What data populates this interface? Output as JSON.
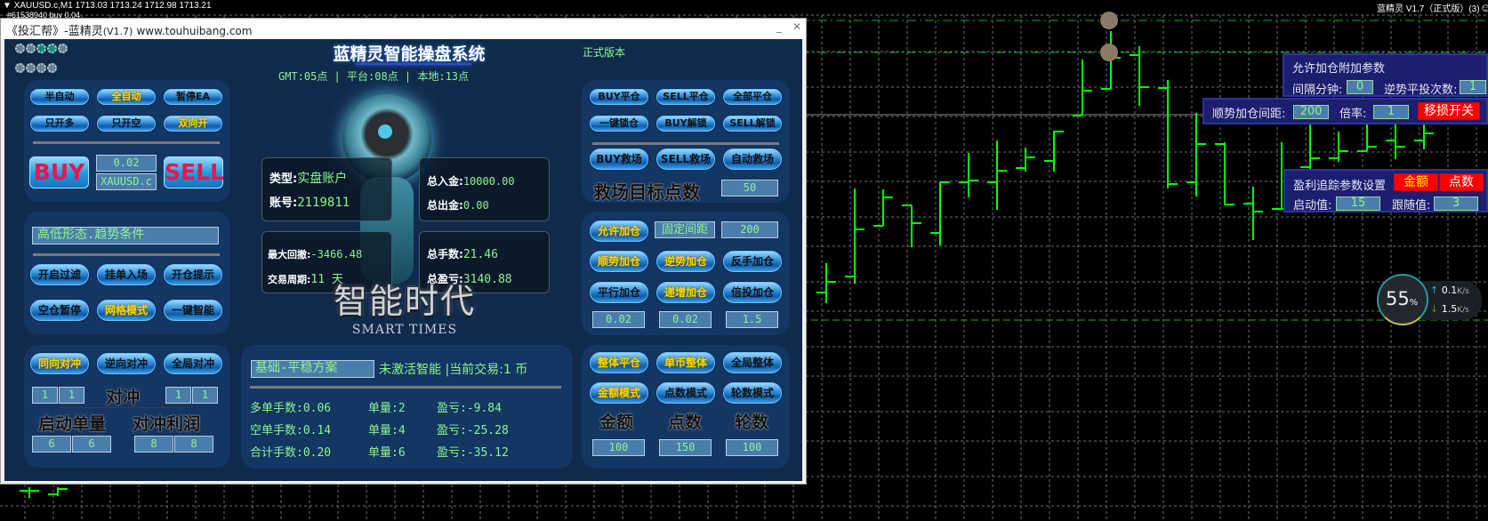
{
  "chart_header": {
    "symbol_line": "XAUUSD.c,M1  1713.03 1713.24 1712.98 1713.21",
    "position_line": "#61538940 buy 0.04",
    "ea_label": "蓝精灵 V1.7（正式版）(3)",
    "smiley": "☺"
  },
  "window": {
    "title_prefix": "《投汇帮》-蓝精灵",
    "version": "(V1.7)",
    "url": "www.touhuibang.com",
    "minimize": "_",
    "close": "✕"
  },
  "header": {
    "title": "蓝精灵智能操盘系统",
    "edition": "正式版本",
    "time_line": "GMT:05点 | 平台:08点 | 本地:13点"
  },
  "left": {
    "p1": {
      "buttons": [
        "半自动",
        "全自动",
        "暂停EA",
        "只开多",
        "只开空",
        "双向开"
      ],
      "buy": "BUY",
      "sell": "SELL",
      "lot": "0.02",
      "symbol": "XAUUSD.c"
    },
    "p2": {
      "condition": "高低形态.趋势条件",
      "buttons": [
        "开启过滤",
        "挂单入场",
        "开仓提示",
        "空仓暂停",
        "网格模式",
        "一键智能"
      ]
    },
    "p3": {
      "buttons": [
        "同向对冲",
        "逆向对冲",
        "全局对冲"
      ],
      "hedge_label": "对冲",
      "hedge_a": [
        "1",
        "1"
      ],
      "hedge_b": [
        "1",
        "1"
      ],
      "start_lot_label": "启动单量",
      "hedge_profit_label": "对冲利润",
      "start_lot": [
        "6",
        "6"
      ],
      "hedge_profit": [
        "8",
        "8"
      ]
    }
  },
  "center": {
    "account": {
      "type_k": "类型:",
      "type_v": "实盘账户",
      "acct_k": "账号:",
      "acct_v": "2119811",
      "dep_k": "总入金:",
      "dep_v": "10000.00",
      "wd_k": "总出金:",
      "wd_v": "0.00",
      "dd_k": "最大回撤:",
      "dd_v": "-3466.48",
      "period_k": "交易周期:",
      "period_v": "11 天",
      "lots_k": "总手数:",
      "lots_v": "21.46",
      "pnl_k": "总盈亏:",
      "pnl_v": "3140.88"
    },
    "logo_cn": "智能时代",
    "logo_en": "SMART TIMES",
    "plan": "基础-平稳方案",
    "status": "未激活智能 |当前交易:1 币",
    "rows": [
      {
        "a": "多单手数:0.06",
        "b": "单量:2",
        "c": "盈亏:-9.84"
      },
      {
        "a": "空单手数:0.14",
        "b": "单量:4",
        "c": "盈亏:-25.28"
      },
      {
        "a": "合计手数:0.20",
        "b": "单量:6",
        "c": "盈亏:-35.12"
      }
    ]
  },
  "right": {
    "p1": {
      "buttons": [
        "BUY平仓",
        "SELL平仓",
        "全部平仓",
        "一键锁仓",
        "BUY解锁",
        "SELL解锁",
        "BUY救场",
        "SELL救场",
        "自动救场"
      ],
      "target_label": "救场目标点数",
      "target": "50"
    },
    "p2": {
      "allow": "允许加仓",
      "fixed": "固定间距",
      "fixed_value": "200",
      "buttons": [
        "顺势加仓",
        "逆势加仓",
        "反手加仓",
        "平行加仓",
        "递增加仓",
        "倍投加仓"
      ],
      "values": [
        "0.02",
        "0.02",
        "1.5"
      ]
    },
    "p3": {
      "buttons": [
        "整体平仓",
        "单币整体",
        "全局整体",
        "金额模式",
        "点数模式",
        "轮数模式"
      ],
      "labels": [
        "金额",
        "点数",
        "轮数"
      ],
      "values": [
        "100",
        "150",
        "100"
      ]
    }
  },
  "overlay": {
    "add": {
      "title": "允许加仓附加参数",
      "interval_label": "间隔分钟:",
      "interval": "0",
      "counter_label": "逆势平投次数:",
      "counter": "1"
    },
    "trend": {
      "spacing_label": "顺势加仓间距:",
      "spacing": "200",
      "ratio_label": "倍率:",
      "ratio": "1",
      "trail_stop": "移损开关"
    },
    "trail": {
      "title": "盈利追踪参数设置",
      "amount": "金额",
      "points": "点数",
      "start_label": "启动值:",
      "start": "15",
      "follow_label": "跟随值:",
      "follow": "3"
    }
  },
  "netmeter": {
    "percent": "55",
    "unit": "%",
    "up": "0.1",
    "down": "1.5",
    "rate_unit": "K/s"
  },
  "colors": {
    "bull": "#00ff00",
    "panel": "#133663",
    "accent": "#ffd400"
  }
}
